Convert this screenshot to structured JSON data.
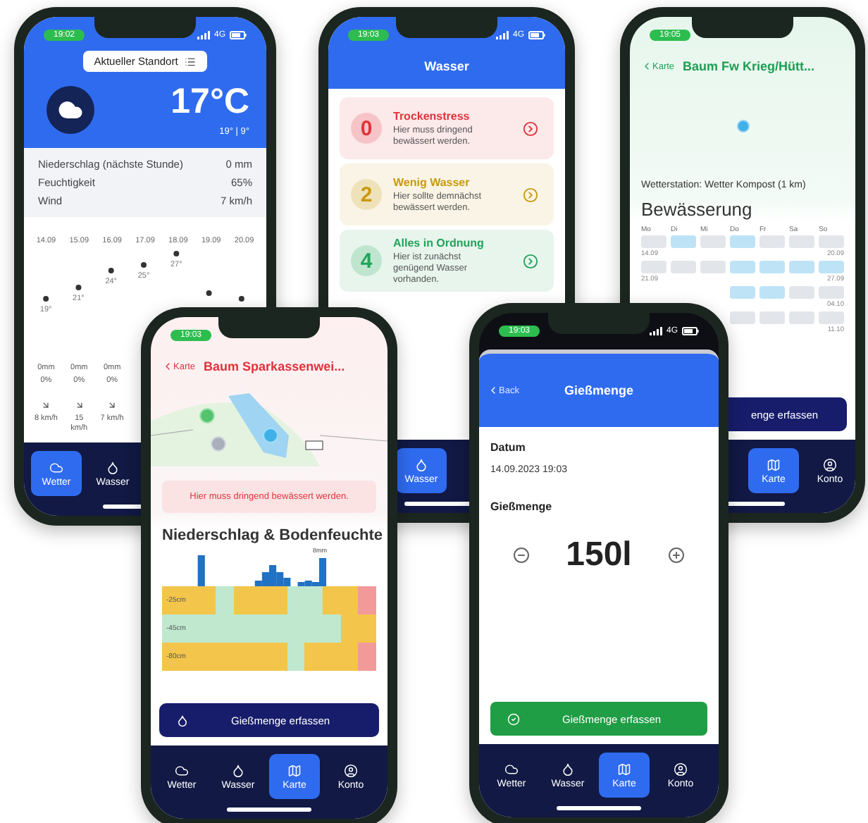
{
  "weather_phone": {
    "time": "19:02",
    "network": "4G",
    "location_button": "Aktueller Standort",
    "temperature": "17°C",
    "range": "19° | 9°",
    "details": [
      {
        "label": "Niederschlag (nächste Stunde)",
        "value": "0 mm"
      },
      {
        "label": "Feuchtigkeit",
        "value": "65%"
      },
      {
        "label": "Wind",
        "value": "7 km/h"
      }
    ],
    "chart_data": {
      "type": "scatter",
      "categories": [
        "14.09",
        "15.09",
        "16.09",
        "17.09",
        "18.09",
        "19.09",
        "20.09"
      ],
      "values": [
        19,
        21,
        24,
        25,
        27,
        20,
        19
      ],
      "value_labels": [
        "19°",
        "21°",
        "24°",
        "25°",
        "27°",
        null,
        null
      ]
    },
    "forecast": [
      {
        "rain": "0mm",
        "chance": "0%",
        "wind": "8 km/h"
      },
      {
        "rain": "0mm",
        "chance": "0%",
        "wind": "15 km/h"
      },
      {
        "rain": "0mm",
        "chance": "0%",
        "wind": "7 km/h"
      }
    ],
    "tabs": [
      {
        "kind": "weather",
        "label": "Wetter",
        "selected": true
      },
      {
        "kind": "water",
        "label": "Wasser",
        "selected": false
      }
    ]
  },
  "water_phone": {
    "time": "19:03",
    "network": "4G",
    "title": "Wasser",
    "cards": [
      {
        "count": "0",
        "title": "Trockenstress",
        "text": "Hier muss dringend bewässert werden.",
        "color": "#e0333c"
      },
      {
        "count": "2",
        "title": "Wenig Wasser",
        "text": "Hier sollte demnächst bewässert werden.",
        "color": "#c99a0e"
      },
      {
        "count": "4",
        "title": "Alles in Ordnung",
        "text": "Hier ist zunächst genügend Wasser vorhanden.",
        "color": "#23a35a"
      }
    ],
    "tabs": [
      {
        "kind": "water",
        "label": "Wasser",
        "selected": true
      }
    ]
  },
  "tree_phone": {
    "time": "19:05",
    "back": "Karte",
    "title": "Baum Fw Krieg/Hütt...",
    "station": "Wetterstation: Wetter Kompost (1 km)",
    "heading": "Bewässerung",
    "weekdays": [
      "Mo",
      "Di",
      "Mi",
      "Do",
      "Fr",
      "Sa",
      "So"
    ],
    "rows": [
      {
        "start": "14.09",
        "end": "20.09",
        "days": [
          {
            "watered": false
          },
          {
            "watered": true
          },
          {
            "watered": false
          },
          {
            "watered": true
          },
          {
            "watered": false
          },
          {
            "watered": false
          },
          {
            "watered": false
          }
        ]
      },
      {
        "start": "21.09",
        "end": "27.09",
        "days": [
          {
            "watered": false
          },
          {
            "watered": false
          },
          {
            "watered": false
          },
          {
            "watered": true
          },
          {
            "watered": true
          },
          {
            "watered": true
          },
          {
            "watered": true
          }
        ]
      },
      {
        "end": "04.10",
        "days": [
          {
            "watered": true
          },
          {
            "watered": true
          },
          {
            "watered": false
          },
          {
            "watered": false
          }
        ]
      },
      {
        "end": "11.10",
        "days": [
          {
            "watered": false
          },
          {
            "watered": false
          },
          {
            "watered": false
          },
          {
            "watered": false
          }
        ]
      }
    ],
    "button": "enge erfassen",
    "tabs": [
      {
        "kind": "map",
        "label": "Karte",
        "selected": true
      },
      {
        "kind": "account",
        "label": "Konto",
        "selected": false
      }
    ]
  },
  "tree_detail_phone": {
    "time": "19:03",
    "back": "Karte",
    "title": "Baum Sparkassenwei...",
    "alert": "Hier muss dringend bewässert werden.",
    "heading": "Niederschlag & Bodenfeuchte",
    "max_label": "8mm",
    "soil": [
      {
        "depth": "-25cm",
        "cells": [
          {
            "color": "#f3c54a"
          },
          {
            "color": "#f3c54a"
          },
          {
            "color": "#f3c54a"
          },
          {
            "color": "#bfe8cf"
          },
          {
            "color": "#f3c54a"
          },
          {
            "color": "#f3c54a"
          },
          {
            "color": "#f3c54a"
          },
          {
            "color": "#bfe8cf"
          },
          {
            "color": "#bfe8cf"
          },
          {
            "color": "#f3c54a"
          },
          {
            "color": "#f3c54a"
          },
          {
            "color": "#f29a9a"
          }
        ]
      },
      {
        "depth": "-45cm",
        "cells": [
          {
            "color": "#bfe8cf"
          },
          {
            "color": "#bfe8cf"
          },
          {
            "color": "#bfe8cf"
          },
          {
            "color": "#bfe8cf"
          },
          {
            "color": "#bfe8cf"
          },
          {
            "color": "#bfe8cf"
          },
          {
            "color": "#bfe8cf"
          },
          {
            "color": "#bfe8cf"
          },
          {
            "color": "#bfe8cf"
          },
          {
            "color": "#bfe8cf"
          },
          {
            "color": "#f3c54a"
          },
          {
            "color": "#f3c54a"
          }
        ]
      },
      {
        "depth": "-80cm",
        "cells": [
          {
            "color": "#f3c54a"
          },
          {
            "color": "#f3c54a"
          },
          {
            "color": "#f3c54a"
          },
          {
            "color": "#f3c54a"
          },
          {
            "color": "#f3c54a"
          },
          {
            "color": "#f3c54a"
          },
          {
            "color": "#f3c54a"
          },
          {
            "color": "#bfe8cf"
          },
          {
            "color": "#f3c54a"
          },
          {
            "color": "#f3c54a"
          },
          {
            "color": "#f3c54a"
          },
          {
            "color": "#f29a9a"
          }
        ]
      }
    ],
    "button": "Gießmenge erfassen",
    "tabs": [
      {
        "kind": "weather",
        "label": "Wetter",
        "selected": false
      },
      {
        "kind": "water",
        "label": "Wasser",
        "selected": false
      },
      {
        "kind": "map",
        "label": "Karte",
        "selected": true
      },
      {
        "kind": "account",
        "label": "Konto",
        "selected": false
      }
    ]
  },
  "amount_phone": {
    "time": "19:03",
    "network": "4G",
    "back": "Back",
    "title": "Gießmenge",
    "date_label": "Datum",
    "date": "14.09.2023 19:03",
    "amount_label": "Gießmenge",
    "amount": "150l",
    "button": "Gießmenge erfassen",
    "tabs": [
      {
        "kind": "weather",
        "label": "Wetter",
        "selected": false
      },
      {
        "kind": "water",
        "label": "Wasser",
        "selected": false
      },
      {
        "kind": "map",
        "label": "Karte",
        "selected": true
      },
      {
        "kind": "account",
        "label": "Konto",
        "selected": false
      }
    ]
  }
}
